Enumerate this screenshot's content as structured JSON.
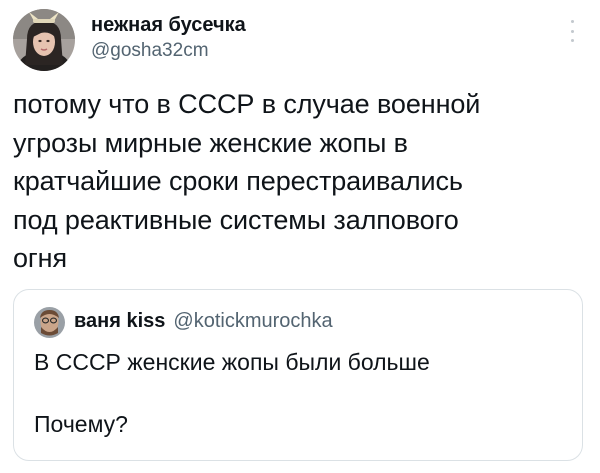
{
  "tweet": {
    "display_name": "нежная бусечка",
    "handle": "@gosha32cm",
    "text": "потому что в СССР в случае военной\nугрозы мирные женские жопы в\nкратчайшие сроки перестраивались\nпод реактивные системы залпового\nогня"
  },
  "quoted_tweet": {
    "display_name": "ваня kiss",
    "handle": "@kotickmurochka",
    "text": "В СССР женские жопы были больше\n\nПочему?"
  },
  "icons": {
    "more": "more-vertical-icon",
    "avatar": "user-avatar",
    "quote_avatar": "quote-user-avatar"
  },
  "colors": {
    "text": "#0f1419",
    "secondary": "#536471",
    "border": "#dbe1e5"
  }
}
